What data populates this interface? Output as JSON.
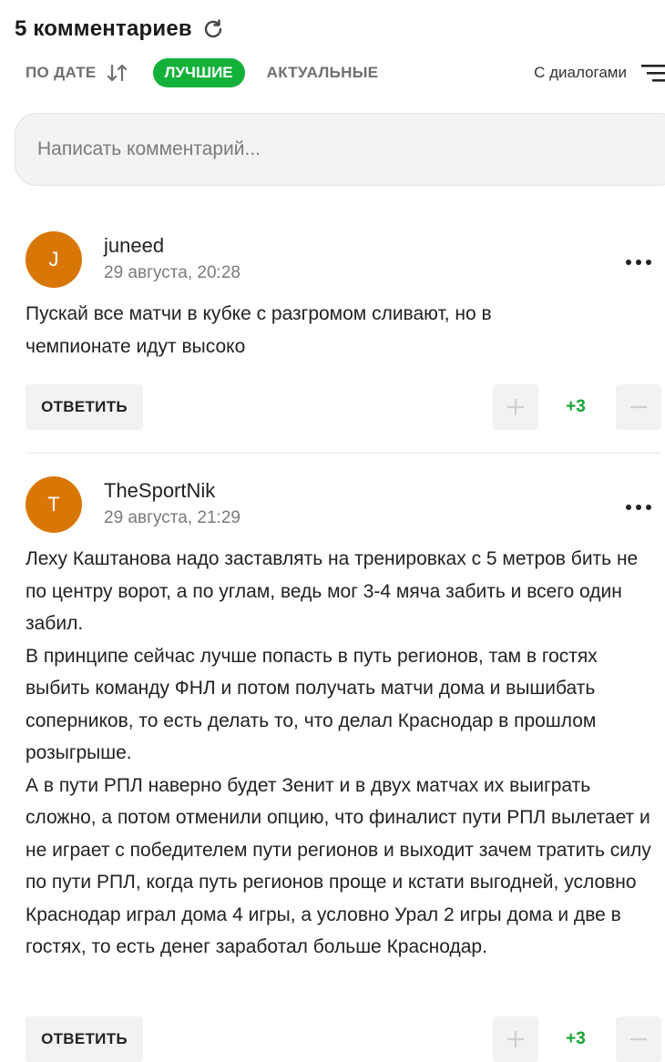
{
  "header": {
    "title": "5 комментариев",
    "refresh_icon": "refresh-icon"
  },
  "filters": {
    "by_date": "ПО ДАТЕ",
    "best": "ЛУЧШИЕ",
    "actual": "АКТУАЛЬНЫЕ",
    "dialogs": "С диалогами",
    "accent_color": "#13b13a"
  },
  "composer": {
    "placeholder": "Написать комментарий..."
  },
  "comments": [
    {
      "avatar_letter": "J",
      "author": "juneed",
      "date": "29 августа, 20:28",
      "text": "Пускай все матчи в кубке с разгромом сливают, но в чемпионате идут высоко",
      "reply_label": "ОТВЕТИТЬ",
      "score": "+3"
    },
    {
      "avatar_letter": "T",
      "author": "TheSportNik",
      "date": "29 августа, 21:29",
      "text": "Леху Каштанова надо заставлять на тренировках с 5 метров бить не по центру ворот, а по углам, ведь мог 3-4 мяча забить и всего один забил.\nВ принципе сейчас лучше попасть в путь регионов, там в гостях выбить команду ФНЛ и потом получать матчи дома и вышибать соперников, то есть делать то, что делал Краснодар в прошлом розыгрыше.\nА в пути РПЛ наверно будет Зенит и в двух матчах их выиграть сложно, а потом отменили опцию, что финалист пути РПЛ вылетает и не играет с победителем пути регионов и выходит зачем тратить силу по пути РПЛ, когда путь регионов проще и кстати выгодней, условно Краснодар играл дома 4 игры, а условно Урал 2 игры дома и две в гостях, то есть денег заработал больше Краснодар.",
      "reply_label": "ОТВЕТИТЬ",
      "score": "+3"
    }
  ],
  "colors": {
    "avatar": "#d97706",
    "score": "#13a534"
  }
}
